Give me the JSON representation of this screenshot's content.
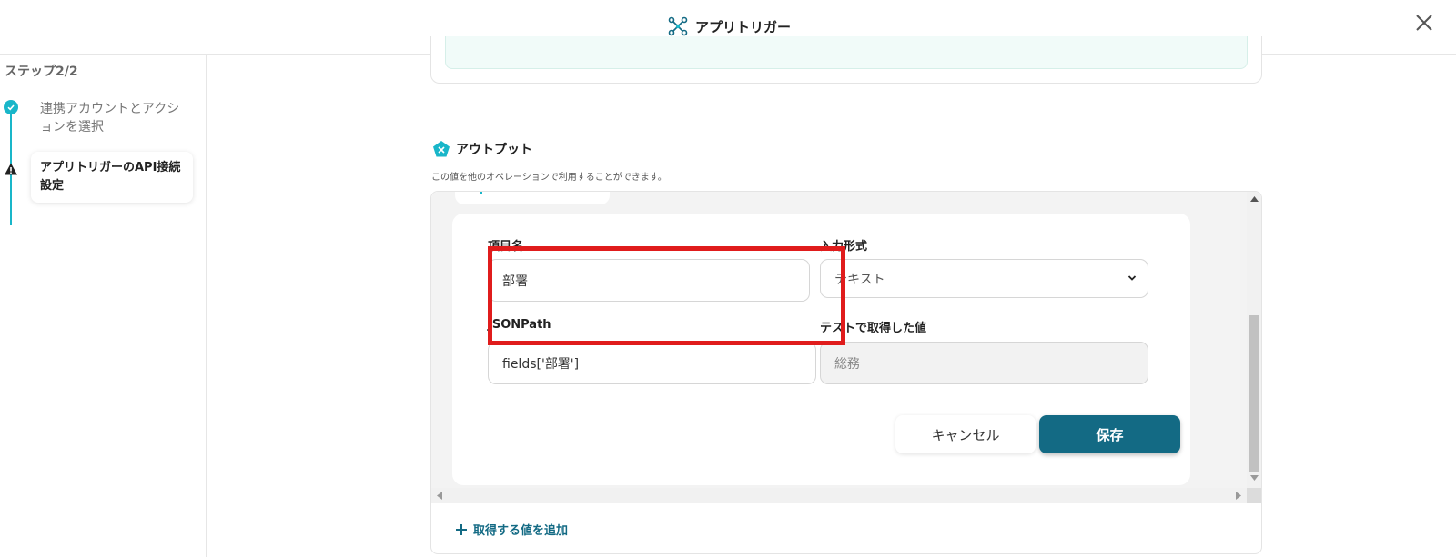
{
  "header": {
    "title": "アプリトリガー",
    "icon": "app-trigger-icon",
    "close_icon": "close-icon"
  },
  "sidebar": {
    "step_count": "ステップ2/2",
    "steps": [
      {
        "label": "連携アカウントとアクションを選択",
        "status": "completed",
        "icon": "check-icon"
      },
      {
        "label": "アプリトリガーのAPI接続設定",
        "status": "warning",
        "icon": "warning-icon"
      }
    ]
  },
  "output": {
    "title": "アウトプット",
    "description": "この値を他のオペレーションで利用することができます。",
    "form": {
      "item_name_label": "項目名",
      "item_name_value": "部署",
      "input_format_label": "入力形式",
      "input_format_value": "テキスト",
      "jsonpath_label": "JSONPath",
      "jsonpath_value": "fields['部署']",
      "test_value_label": "テストで取得した値",
      "test_value": "総務",
      "cancel_label": "キャンセル",
      "save_label": "保存"
    },
    "add_value_label": "取得する値を追加"
  },
  "colors": {
    "accent": "#19b6c9",
    "primary_button": "#136a84",
    "highlight": "#e01c1c"
  }
}
